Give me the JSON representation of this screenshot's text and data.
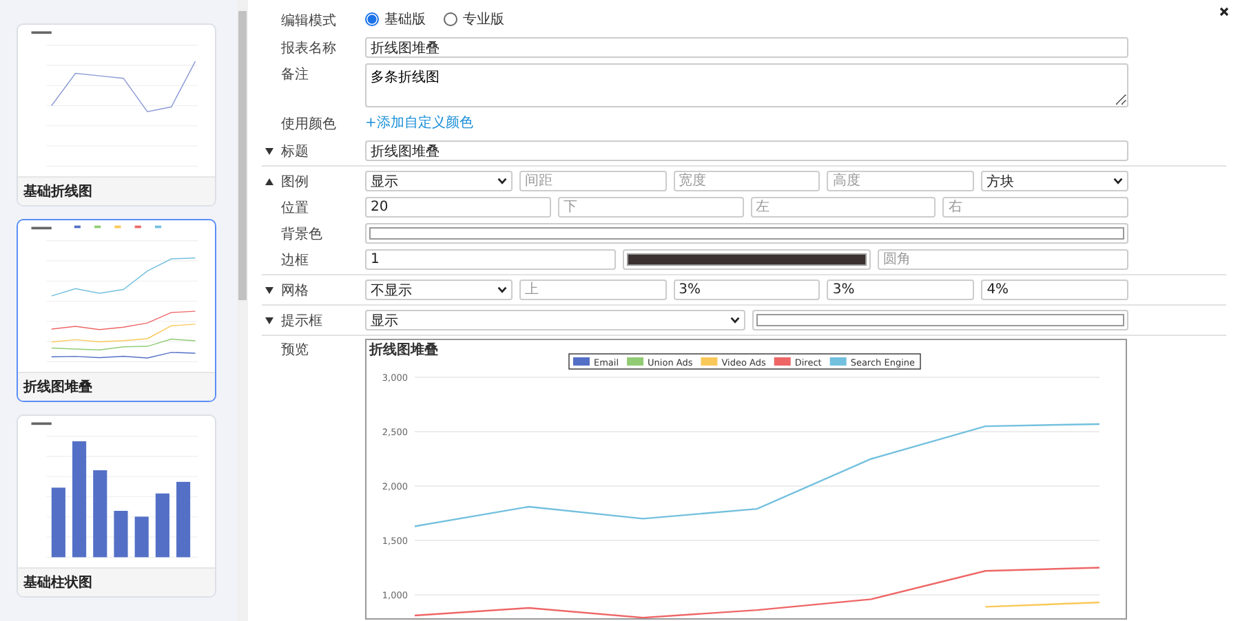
{
  "sidebar": {
    "cards": [
      {
        "title": "基础折线图",
        "kind": "line",
        "selected": false
      },
      {
        "title": "折线图堆叠",
        "kind": "stacked-line",
        "selected": true
      },
      {
        "title": "基础柱状图",
        "kind": "bar",
        "selected": false
      }
    ]
  },
  "form": {
    "mode": {
      "label": "编辑模式",
      "options": [
        {
          "label": "基础版",
          "selected": true
        },
        {
          "label": "专业版",
          "selected": false
        }
      ]
    },
    "report_name": {
      "label": "报表名称",
      "value": "折线图堆叠"
    },
    "note": {
      "label": "备注",
      "value": "多条折线图"
    },
    "colors": {
      "label": "使用颜色",
      "link": "+添加自定义颜色"
    },
    "sections": [
      {
        "rows": [
          {
            "label": "标题",
            "expanded": false,
            "fields": [
              {
                "kind": "input",
                "value": "折线图堆叠"
              }
            ]
          }
        ]
      },
      {
        "rows": [
          {
            "label": "图例",
            "expanded": true,
            "fields": [
              {
                "kind": "select",
                "value": "显示"
              },
              {
                "kind": "input",
                "placeholder": "间距"
              },
              {
                "kind": "input",
                "placeholder": "宽度"
              },
              {
                "kind": "input",
                "placeholder": "高度"
              },
              {
                "kind": "select",
                "value": "方块"
              }
            ]
          },
          {
            "label": "位置",
            "fields": [
              {
                "kind": "input",
                "value": "20"
              },
              {
                "kind": "input",
                "placeholder": "下"
              },
              {
                "kind": "input",
                "placeholder": "左"
              },
              {
                "kind": "input",
                "placeholder": "右"
              }
            ]
          },
          {
            "label": "背景色",
            "fields": [
              {
                "kind": "color",
                "color": "#ffffff"
              }
            ]
          },
          {
            "label": "边框",
            "fields": [
              {
                "kind": "input",
                "value": "1"
              },
              {
                "kind": "color",
                "color": "#3b3131"
              },
              {
                "kind": "input",
                "placeholder": "圆角"
              }
            ]
          }
        ]
      },
      {
        "rows": [
          {
            "label": "网格",
            "expanded": false,
            "fields": [
              {
                "kind": "select",
                "value": "不显示"
              },
              {
                "kind": "input",
                "placeholder": "上"
              },
              {
                "kind": "input",
                "value": "3%"
              },
              {
                "kind": "input",
                "value": "3%"
              },
              {
                "kind": "input",
                "value": "4%"
              }
            ]
          }
        ]
      },
      {
        "rows": [
          {
            "label": "提示框",
            "expanded": false,
            "fields": [
              {
                "kind": "select",
                "value": "显示"
              },
              {
                "kind": "color",
                "color": "#ffffff"
              }
            ]
          }
        ]
      }
    ],
    "preview": {
      "label": "预览",
      "chart_data": {
        "type": "line",
        "title": "折线图堆叠",
        "grid": true,
        "legend": true,
        "ylim": [
          780,
          3000
        ],
        "yticks": [
          {
            "value": 1000,
            "label": "1,000"
          },
          {
            "value": 1500,
            "label": "1,500"
          },
          {
            "value": 2000,
            "label": "2,000"
          },
          {
            "value": 2500,
            "label": "2,500"
          },
          {
            "value": 3000,
            "label": "3,000"
          }
        ],
        "series": [
          {
            "name": "Email",
            "color": "#5470c6",
            "values": [
              null,
              null,
              null,
              null,
              null,
              null,
              null
            ]
          },
          {
            "name": "Union Ads",
            "color": "#91cc75",
            "values": [
              null,
              null,
              null,
              null,
              null,
              null,
              null
            ]
          },
          {
            "name": "Video Ads",
            "color": "#fac858",
            "values": [
              null,
              null,
              null,
              null,
              null,
              890,
              930
            ]
          },
          {
            "name": "Direct",
            "color": "#ee6666",
            "values": [
              810,
              880,
              790,
              860,
              960,
              1220,
              1250
            ]
          },
          {
            "name": "Search Engine",
            "color": "#73c0de",
            "values": [
              1630,
              1810,
              1700,
              1790,
              2250,
              2550,
              2570
            ]
          }
        ]
      }
    }
  }
}
